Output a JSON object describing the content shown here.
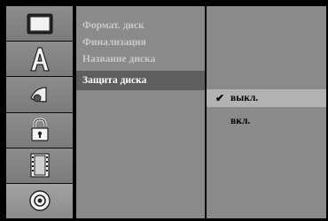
{
  "icon_column": [
    {
      "icon": "tv-screen-icon",
      "selected": false
    },
    {
      "icon": "letter-a-icon",
      "selected": false
    },
    {
      "icon": "audio-speaker-icon",
      "selected": false
    },
    {
      "icon": "padlock-icon",
      "selected": false
    },
    {
      "icon": "film-strip-icon",
      "selected": false
    },
    {
      "icon": "disc-icon",
      "selected": true
    }
  ],
  "menu": {
    "items": [
      {
        "label": "Формат. диск"
      },
      {
        "label": "Финализация"
      },
      {
        "label": "Название диска"
      },
      {
        "label": "Защита диска"
      }
    ],
    "active_index": 3
  },
  "options": {
    "items": [
      {
        "label": "выкл.",
        "checked": true
      },
      {
        "label": "вкл.",
        "checked": false
      }
    ]
  },
  "colors": {
    "background": "#000000",
    "panel": "#8a8a8a",
    "menu_active": "#5e5e5e",
    "option_selected": "#b2b2b2",
    "text_dim": "#c8c8c8",
    "text_active": "#ffffff"
  }
}
